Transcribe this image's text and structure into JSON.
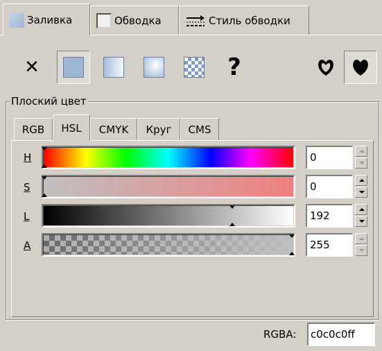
{
  "tabs": [
    {
      "label": "Заливка",
      "icon": "fill-icon",
      "active": true
    },
    {
      "label": "Обводка",
      "icon": "stroke-paint-icon",
      "active": false
    },
    {
      "label": "Стиль обводки",
      "icon": "stroke-style-icon",
      "active": false
    }
  ],
  "fill_modes": [
    {
      "name": "no-paint",
      "glyph": "✕"
    },
    {
      "name": "flat-color",
      "active": true
    },
    {
      "name": "linear-gradient"
    },
    {
      "name": "radial-gradient"
    },
    {
      "name": "pattern"
    },
    {
      "name": "unset",
      "glyph": "?"
    }
  ],
  "fill_rules": [
    {
      "name": "evenodd-icon"
    },
    {
      "name": "nonzero-icon",
      "active": true
    }
  ],
  "group_label": "Плоский цвет",
  "color_tabs": [
    "RGB",
    "HSL",
    "CMYK",
    "Круг",
    "CMS"
  ],
  "active_color_tab": "HSL",
  "sliders": [
    {
      "label": "H",
      "value": "0",
      "level": 0
    },
    {
      "label": "S",
      "value": "0",
      "level": 0
    },
    {
      "label": "L",
      "value": "192",
      "level": 0.753
    },
    {
      "label": "A",
      "value": "255",
      "level": 1.0
    }
  ],
  "rgba_label": "RGBA:",
  "rgba_value": "c0c0c0ff",
  "colors": {
    "panel_bg": "#d4d0c8",
    "flat_swatch": "#9db5d6",
    "current_color": "#c0c0c0"
  }
}
